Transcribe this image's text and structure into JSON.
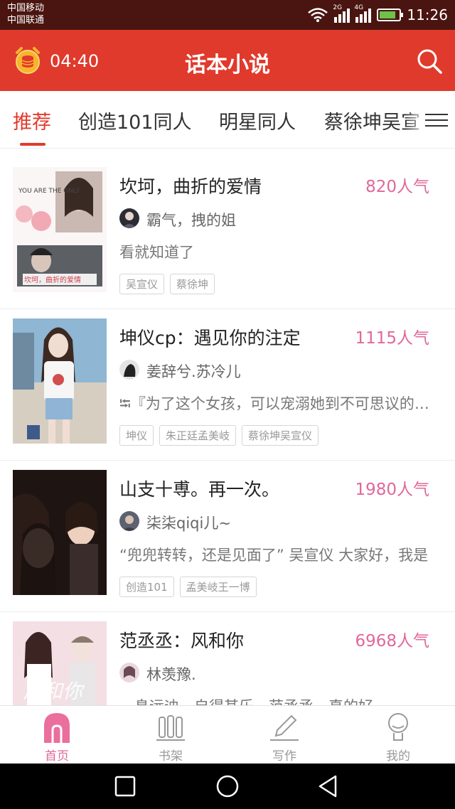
{
  "status_bar": {
    "carrier1": "中国移动",
    "carrier2": "中国联通",
    "signal1_label": "2G",
    "signal2_label": "4G",
    "time": "11:26"
  },
  "header": {
    "timer": "04:40",
    "title": "话本小说",
    "accent_color": "#e03a2c"
  },
  "tabs": [
    {
      "label": "推荐",
      "active": true
    },
    {
      "label": "创造101同人"
    },
    {
      "label": "明星同人"
    },
    {
      "label": "蔡徐坤吴宣"
    }
  ],
  "stories": [
    {
      "title": "坎坷，曲折的爱情",
      "popularity": "820人气",
      "author": "霸气，拽的姐",
      "desc": "看就知道了",
      "tags": [
        "吴宣仪",
        "蔡徐坤"
      ],
      "cover_text1": "YOU ARE THE ONLY",
      "cover_text2": "坎坷，曲折的爱情"
    },
    {
      "title": "坤仪cp：遇见你的注定",
      "popularity": "1115人气",
      "author": "姜辞兮.苏冷儿",
      "desc": "⭾『为了这个女孩，可以宠溺她到不可思议的地步』",
      "tags": [
        "坤仪",
        "朱正廷孟美岐",
        "蔡徐坤吴宣仪"
      ]
    },
    {
      "title": "山支十尃。再一次。",
      "popularity": "1980人气",
      "author": "柒柒qiqi儿~",
      "desc": "“兜兜转转，还是见面了” 吴宣仪 大家好，我是",
      "tags": [
        "创造101",
        "孟美岐王一博"
      ]
    },
    {
      "title": "范丞丞：风和你",
      "popularity": "6968人气",
      "author": "林羡豫.",
      "desc": "…息远迪，自得其乐，范丞丞，真的好",
      "tags": [],
      "cover_text": "风和你"
    }
  ],
  "bottom_nav": [
    {
      "label": "首页",
      "icon": "home-icon",
      "active": true
    },
    {
      "label": "书架",
      "icon": "bookshelf-icon"
    },
    {
      "label": "写作",
      "icon": "pen-icon"
    },
    {
      "label": "我的",
      "icon": "profile-icon"
    }
  ]
}
